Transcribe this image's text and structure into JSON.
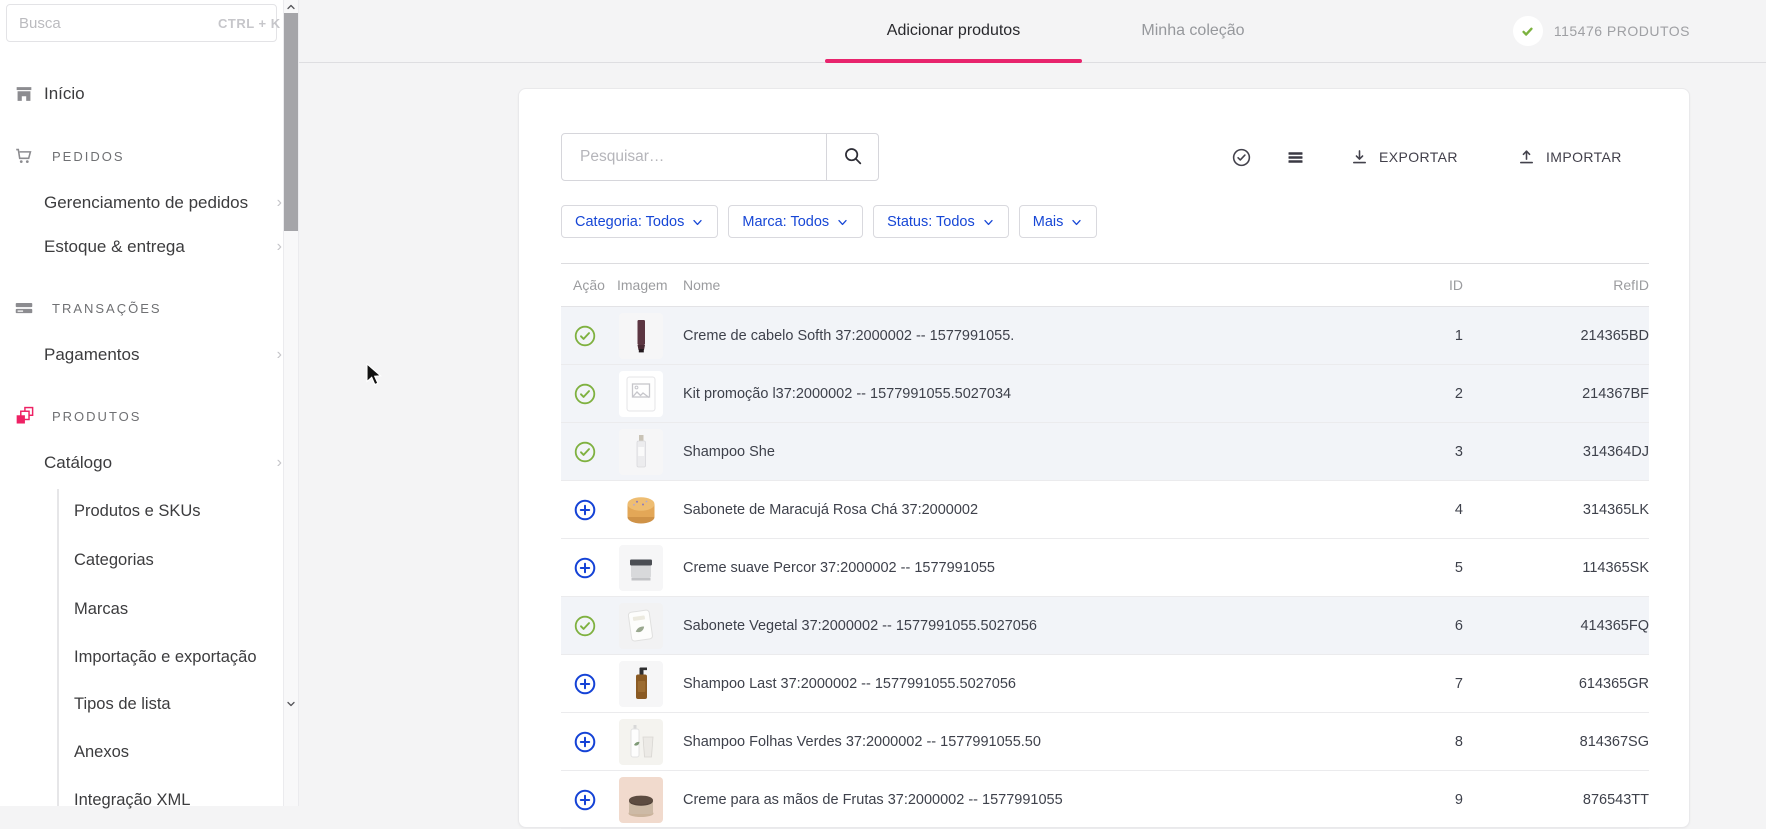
{
  "sidebar": {
    "search": {
      "placeholder": "Busca",
      "shortcut": "CTRL + K"
    },
    "items": [
      {
        "type": "item",
        "icon": "store-icon",
        "label": "Início"
      },
      {
        "type": "section",
        "icon": "cart-icon",
        "label": "PEDIDOS"
      },
      {
        "type": "item",
        "label": "Gerenciamento de pedidos",
        "chevron": true
      },
      {
        "type": "item",
        "label": "Estoque & entrega",
        "chevron": true
      },
      {
        "type": "section",
        "icon": "card-icon",
        "label": "TRANSAÇÕES"
      },
      {
        "type": "item",
        "label": "Pagamentos",
        "chevron": true
      },
      {
        "type": "section",
        "icon": "products-icon",
        "label": "PRODUTOS"
      },
      {
        "type": "item",
        "label": "Catálogo",
        "chevron": true
      },
      {
        "type": "subitem",
        "label": "Produtos e SKUs"
      },
      {
        "type": "subitem",
        "label": "Categorias"
      },
      {
        "type": "subitem",
        "label": "Marcas"
      },
      {
        "type": "subitem",
        "label": "Importação e exportação"
      },
      {
        "type": "subitem",
        "label": "Tipos de lista"
      },
      {
        "type": "subitem",
        "label": "Anexos"
      },
      {
        "type": "subitem",
        "label": "Integração XML"
      }
    ]
  },
  "header": {
    "tabs": [
      {
        "label": "Adicionar produtos",
        "active": true
      },
      {
        "label": "Minha coleção",
        "active": false
      }
    ],
    "badge": {
      "icon": "check-icon",
      "label": "115476 PRODUTOS"
    }
  },
  "toolbar": {
    "search_placeholder": "Pesquisar…",
    "export_label": "EXPORTAR",
    "import_label": "IMPORTAR"
  },
  "filters": [
    {
      "label": "Categoria: Todos"
    },
    {
      "label": "Marca: Todos"
    },
    {
      "label": "Status: Todos"
    },
    {
      "label": "Mais"
    }
  ],
  "table": {
    "columns": [
      "Ação",
      "Imagem",
      "Nome",
      "ID",
      "RefID"
    ],
    "rows": [
      {
        "action": "added",
        "image_kind": "tube-maroon",
        "name": "Creme de cabelo Softh 37:2000002 -- 1577991055.",
        "id": "1",
        "refid": "214365BD",
        "highlight": true
      },
      {
        "action": "added",
        "image_kind": "placeholder",
        "name": "Kit promoção l37:2000002 -- 1577991055.5027034",
        "id": "2",
        "refid": "214367BF",
        "highlight": true
      },
      {
        "action": "added",
        "image_kind": "bottle-white",
        "name": "Shampoo She",
        "id": "3",
        "refid": "314364DJ",
        "highlight": true
      },
      {
        "action": "add",
        "image_kind": "soap-round",
        "name": "Sabonete de Maracujá Rosa Chá 37:2000002",
        "id": "4",
        "refid": "314365LK",
        "highlight": false
      },
      {
        "action": "add",
        "image_kind": "jar-gray",
        "name": "Creme suave Percor 37:2000002 -- 1577991055",
        "id": "5",
        "refid": "114365SK",
        "highlight": false
      },
      {
        "action": "added",
        "image_kind": "soap-pack",
        "name": "Sabonete Vegetal 37:2000002 -- 1577991055.5027056",
        "id": "6",
        "refid": "414365FQ",
        "highlight": true
      },
      {
        "action": "add",
        "image_kind": "bottle-amber",
        "name": "Shampoo Last 37:2000002 -- 1577991055.5027056",
        "id": "7",
        "refid": "614365GR",
        "highlight": false
      },
      {
        "action": "add",
        "image_kind": "bottles-pair",
        "name": "Shampoo Folhas Verdes 37:2000002 -- 1577991055.50",
        "id": "8",
        "refid": "814367SG",
        "highlight": false
      },
      {
        "action": "add",
        "image_kind": "jar-pink",
        "name": "Creme para as mãos de Frutas 37:2000002 -- 1577991055",
        "id": "9",
        "refid": "876543TT",
        "highlight": false
      }
    ]
  },
  "colors": {
    "accent_pink": "#e8246d",
    "link_blue": "#134cd8",
    "success_green": "#7cb23f",
    "row_highlight": "#f2f4f8"
  }
}
